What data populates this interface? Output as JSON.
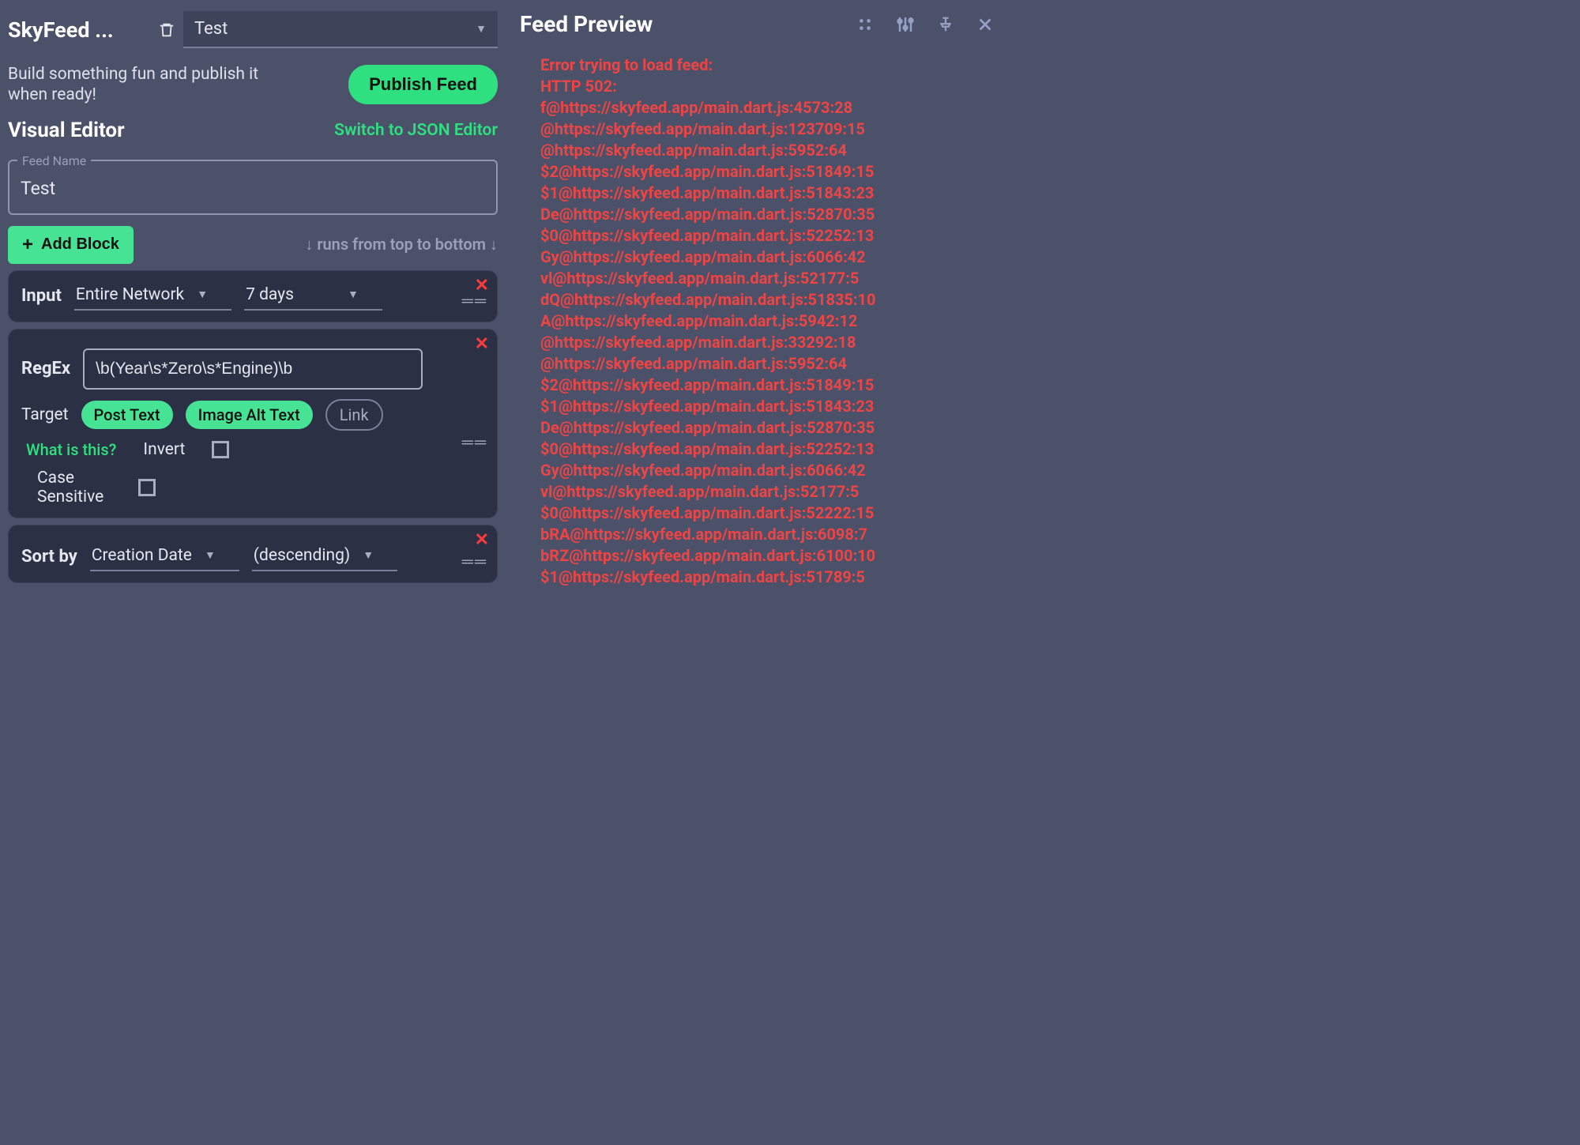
{
  "header": {
    "app_title": "SkyFeed ...",
    "tab_selected": "Test"
  },
  "subhead": {
    "text": "Build something fun and publish it when ready!",
    "publish_label": "Publish Feed"
  },
  "editor": {
    "title": "Visual Editor",
    "switch_label": "Switch to JSON Editor",
    "feed_name_label": "Feed Name",
    "feed_name_value": "Test",
    "add_block_label": "Add Block",
    "runs_hint": "↓ runs from top to bottom ↓"
  },
  "blocks": {
    "input": {
      "label": "Input",
      "source": "Entire Network",
      "duration": "7 days"
    },
    "regex": {
      "label": "RegEx",
      "value": "\\b(Year\\s*Zero\\s*Engine)\\b",
      "target_label": "Target",
      "target_post_text": "Post Text",
      "target_alt_text": "Image Alt Text",
      "target_link": "Link",
      "what_is_this": "What is this?",
      "invert_label": "Invert",
      "case_sensitive_label": "Case Sensitive"
    },
    "sort": {
      "label": "Sort by",
      "field": "Creation Date",
      "direction": "(descending)"
    }
  },
  "preview": {
    "title": "Feed Preview",
    "error_lines": [
      "Error trying to load feed:",
      "HTTP 502:",
      "f@https://skyfeed.app/main.dart.js:4573:28",
      "@https://skyfeed.app/main.dart.js:123709:15",
      "@https://skyfeed.app/main.dart.js:5952:64",
      "$2@https://skyfeed.app/main.dart.js:51849:15",
      "$1@https://skyfeed.app/main.dart.js:51843:23",
      "De@https://skyfeed.app/main.dart.js:52870:35",
      "$0@https://skyfeed.app/main.dart.js:52252:13",
      "Gy@https://skyfeed.app/main.dart.js:6066:42",
      "vl@https://skyfeed.app/main.dart.js:52177:5",
      "dQ@https://skyfeed.app/main.dart.js:51835:10",
      "A@https://skyfeed.app/main.dart.js:5942:12",
      "@https://skyfeed.app/main.dart.js:33292:18",
      "@https://skyfeed.app/main.dart.js:5952:64",
      "$2@https://skyfeed.app/main.dart.js:51849:15",
      "$1@https://skyfeed.app/main.dart.js:51843:23",
      "De@https://skyfeed.app/main.dart.js:52870:35",
      "$0@https://skyfeed.app/main.dart.js:52252:13",
      "Gy@https://skyfeed.app/main.dart.js:6066:42",
      "vl@https://skyfeed.app/main.dart.js:52177:5",
      "$0@https://skyfeed.app/main.dart.js:52222:15",
      "bRA@https://skyfeed.app/main.dart.js:6098:7",
      "bRZ@https://skyfeed.app/main.dart.js:6100:10",
      "$1@https://skyfeed.app/main.dart.js:51789:5"
    ]
  }
}
